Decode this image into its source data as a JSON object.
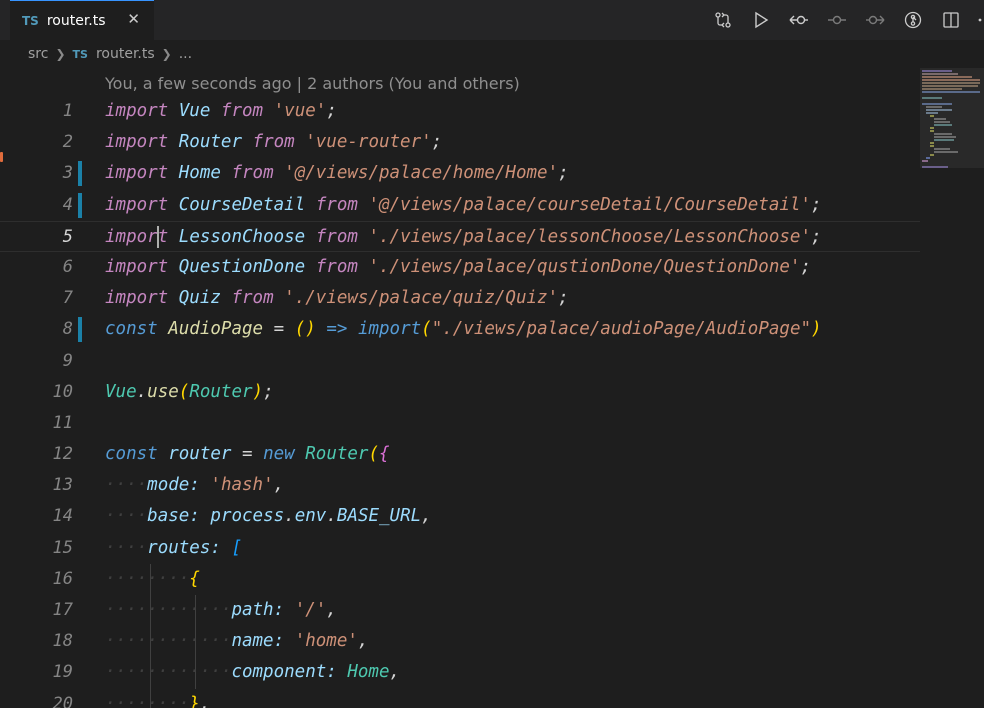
{
  "tab": {
    "badge": "TS",
    "label": "router.ts",
    "close": "✕"
  },
  "toolbar": {
    "actions": [
      "open-changes",
      "run",
      "go-back",
      "previous-change",
      "next-change",
      "blame",
      "split-editor",
      "more"
    ]
  },
  "breadcrumb": {
    "folder": "src",
    "badge": "TS",
    "file": "router.ts",
    "more": "..."
  },
  "codelens": "You, a few seconds ago | 2 authors (You and others)",
  "line_numbers": [
    "1",
    "2",
    "3",
    "4",
    "5",
    "6",
    "7",
    "8",
    "9",
    "10",
    "11",
    "12",
    "13",
    "14",
    "15",
    "16",
    "17",
    "18",
    "19",
    "20"
  ],
  "code": {
    "l1": {
      "kw": "import",
      "id": "Vue",
      "from": "from",
      "str": "'vue'",
      "semi": ";"
    },
    "l2": {
      "kw": "import",
      "id": "Router",
      "from": "from",
      "str": "'vue-router'",
      "semi": ";"
    },
    "l3": {
      "kw": "import",
      "id": "Home",
      "from": "from",
      "str": "'@/views/palace/home/Home'",
      "semi": ";"
    },
    "l4": {
      "kw": "import",
      "id": "CourseDetail",
      "from": "from",
      "str": "'@/views/palace/courseDetail/CourseDetail'",
      "semi": ";"
    },
    "l5": {
      "kw_a": "impor",
      "kw_b": "t",
      "id": "LessonChoose",
      "from": "from",
      "str": "'./views/palace/lessonChoose/LessonChoose'",
      "semi": ";"
    },
    "l6": {
      "kw": "import",
      "id": "QuestionDone",
      "from": "from",
      "str": "'./views/palace/qustionDone/QuestionDone'",
      "semi": ";"
    },
    "l7": {
      "kw": "import",
      "id": "Quiz",
      "from": "from",
      "str": "'./views/palace/quiz/Quiz'",
      "semi": ";"
    },
    "l8": {
      "const": "const",
      "id": "AudioPage",
      "eq": "=",
      "paren": "()",
      "arrow": "=>",
      "fn": "import",
      "open": "(",
      "str": "\"./views/palace/audioPage/AudioPage\"",
      "close": ")"
    },
    "l10": {
      "obj": "Vue",
      "dot": ".",
      "fn": "use",
      "open": "(",
      "arg": "Router",
      "close": ")",
      "semi": ";"
    },
    "l12": {
      "const": "const",
      "id": "router",
      "eq": "=",
      "new": "new",
      "ty": "Router",
      "paren": "(",
      "brace": "{"
    },
    "l13": {
      "key": "mode",
      "colon": ":",
      "str": "'hash'",
      "comma": ","
    },
    "l14": {
      "key": "base",
      "colon": ":",
      "obj": "process",
      "dot1": ".",
      "env": "env",
      "dot2": ".",
      "prop": "BASE_URL",
      "comma": ","
    },
    "l15": {
      "key": "routes",
      "colon": ":",
      "bracket": "["
    },
    "l16": {
      "brace": "{"
    },
    "l17": {
      "key": "path",
      "colon": ":",
      "str": "'/'",
      "comma": ","
    },
    "l18": {
      "key": "name",
      "colon": ":",
      "str": "'home'",
      "comma": ","
    },
    "l19": {
      "key": "component",
      "colon": ":",
      "val": "Home",
      "comma": ","
    },
    "l20": {
      "brace": "}",
      "comma": ","
    }
  },
  "colors": {
    "background": "#1e1e1e",
    "keyword": "#c586c0",
    "storage": "#569cd6",
    "variable": "#9cdcfe",
    "string": "#ce9178",
    "type": "#4ec9b0",
    "function": "#dcdcaa",
    "bracket_1": "#ffd700",
    "bracket_2": "#da70d6",
    "bracket_3": "#179fff",
    "modified_gutter": "#1b81a8"
  }
}
